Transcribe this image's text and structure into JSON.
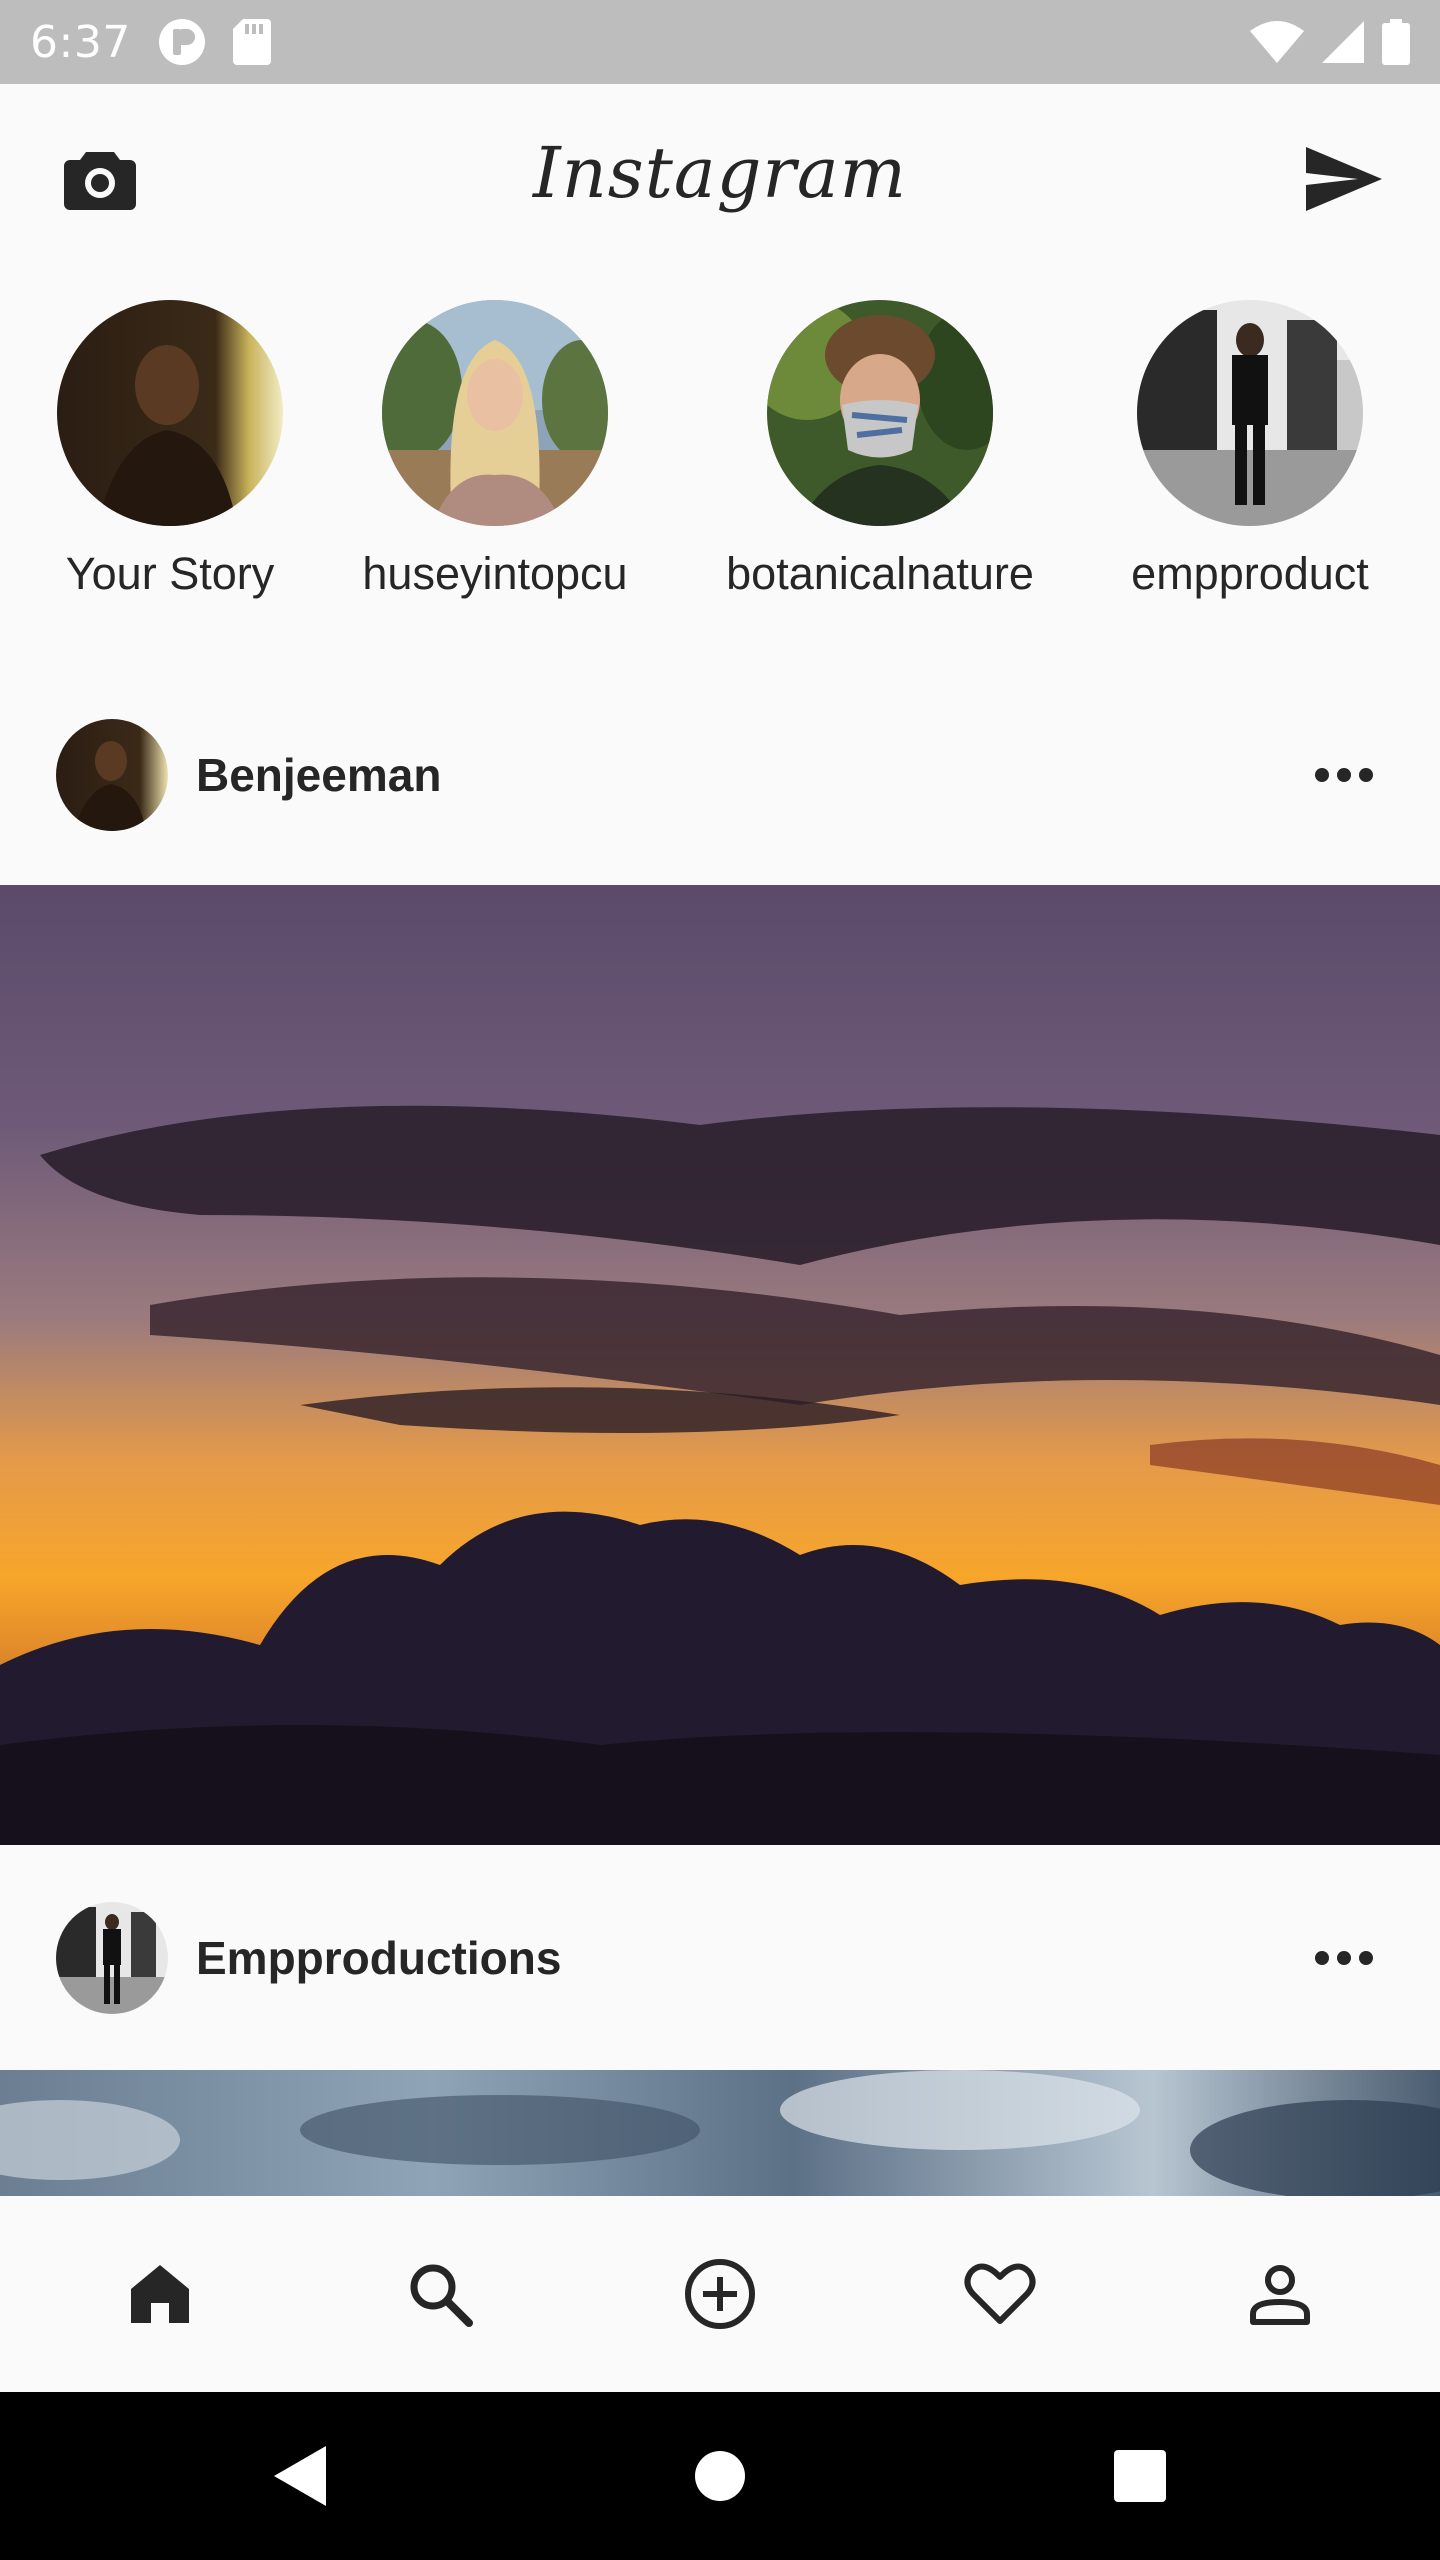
{
  "status_bar": {
    "time": "6:37",
    "icons": [
      "notification-app-icon",
      "sd-card-icon",
      "wifi-icon",
      "cellular-signal-icon",
      "battery-icon"
    ]
  },
  "header": {
    "brand": "Instagram",
    "left_icon": "camera-icon",
    "right_icon": "direct-message-icon"
  },
  "stories": [
    {
      "label": "Your Story"
    },
    {
      "label": "huseyintopcu"
    },
    {
      "label": "botanicalnature"
    },
    {
      "label": "empproduct"
    }
  ],
  "posts": [
    {
      "username": "Benjeeman",
      "more_icon": "more-options-icon"
    },
    {
      "username": "Empproductions",
      "more_icon": "more-options-icon"
    }
  ],
  "bottom_nav": [
    "home-icon",
    "search-icon",
    "add-post-icon",
    "activity-heart-icon",
    "profile-icon"
  ],
  "system_nav": [
    "back-icon",
    "home-circle-icon",
    "recents-icon"
  ],
  "colors": {
    "status_bar_bg": "#bdbdbd",
    "app_bg": "#fafafa",
    "text_primary": "#262626",
    "system_nav_bg": "#000000"
  }
}
